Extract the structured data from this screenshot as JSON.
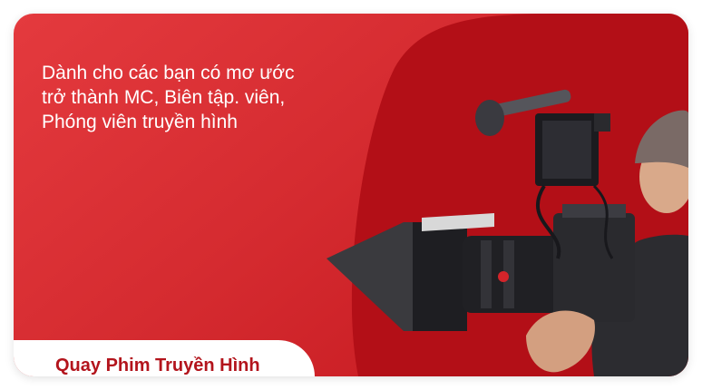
{
  "banner": {
    "tagline_lines": [
      "Dành cho các bạn có mơ ước",
      "trở thành MC, Biên tập. viên,",
      "Phóng viên truyền hình"
    ],
    "course_label": "Quay Phim Truyền Hình"
  },
  "colors": {
    "brand_red": "#d52b30",
    "deep_red": "#b30f17",
    "label_text": "#b3141c",
    "background": "#ffffff"
  },
  "image": {
    "subject": "camera-operator-with-cinema-camera"
  }
}
